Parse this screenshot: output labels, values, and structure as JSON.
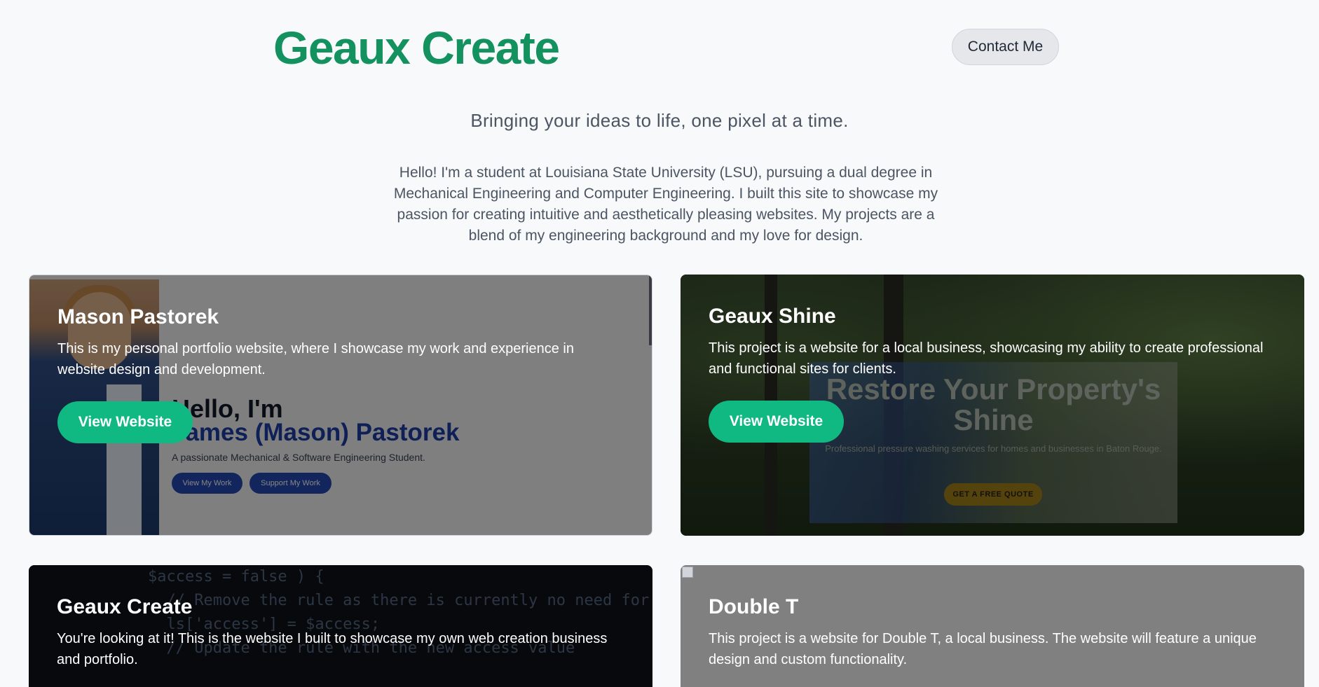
{
  "header": {
    "logo": "Geaux Create",
    "contact_label": "Contact Me"
  },
  "hero": {
    "tagline": "Bringing your ideas to life, one pixel at a time.",
    "intro": "Hello! I'm a student at Louisiana State University (LSU), pursuing a dual degree in Mechanical Engineering and Computer Engineering. I built this site to showcase my passion for creating intuitive and aesthetically pleasing websites. My projects are a blend of my engineering background and my love for design."
  },
  "projects": [
    {
      "title": "Mason Pastorek",
      "description": "This is my personal portfolio website, where I showcase my work and experience in website design and development.",
      "button": "View Website",
      "preview": {
        "hello": "Hello, I'm",
        "name": "James (Mason) Pastorek",
        "subtitle": "A passionate Mechanical & Software Engineering Student.",
        "btn1": "View My Work",
        "btn2": "Support My Work"
      }
    },
    {
      "title": "Geaux Shine",
      "description": "This project is a website for a local business, showcasing my ability to create professional and functional sites for clients.",
      "button": "View Website",
      "preview": {
        "headline": "Restore Your Property's Shine",
        "subtitle": "Professional pressure washing services for homes and businesses in Baton Rouge.",
        "cta": "GET A FREE QUOTE"
      }
    },
    {
      "title": "Geaux Create",
      "description": "You're looking at it! This is the website I built to showcase my own web creation business and portfolio.",
      "preview": {
        "code": "$access = false ) {\n  // Remove the rule as there is currently no need for it\n  ls['access'] = $access;\n  // Update the rule with the new access value"
      }
    },
    {
      "title": "Double T",
      "description": "This project is a website for Double T, a local business. The website will feature a unique design and custom functionality."
    }
  ],
  "colors": {
    "brand": "#13915f",
    "button": "#10b981",
    "background": "#f8f9fb"
  }
}
